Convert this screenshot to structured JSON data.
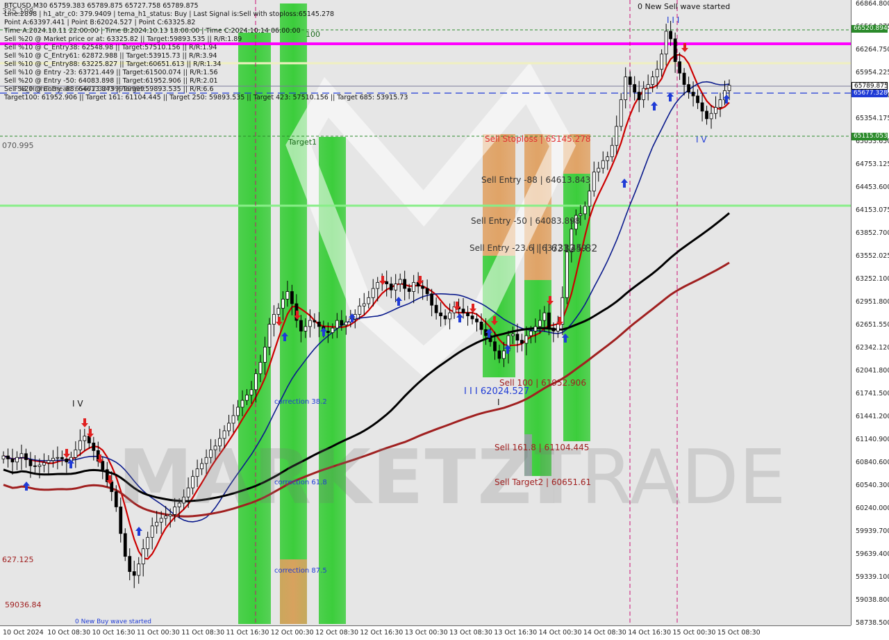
{
  "header": {
    "title_line": "BTCUSD,M30  65759.383 65789.875 65727.758 65789.875",
    "lines": [
      "Line:2898 | h1_atr_c0: 379.9409 | tema_h1_status: Buy | Last Signal is:Sell with stoploss:65145.278",
      "Point A:63397.441 | Point B:62024.527 | Point C:63325.82",
      "Time A:2024.10.11 22:00:00 | Time B:2024.10.13 18:00:00 | Time C:2024.10.14 06:00:00",
      "Sell %20 @ Market price or at: 63325.82 || Target:59893.535 || R/R:1.89",
      "Sell %10 @ C_Entry38: 62548.98 || Target:57510.156 || R/R:1.94",
      "Sell %10 @ C_Entry61: 62872.988 || Target:53915.73 || R/R:3.94",
      "Sell %10 @ C_Entry88: 63225.827 || Target:60651.613 || R/R:1.34",
      "Sell %10 @ Entry -23: 63721.449 || Target:61500.074 || R/R:1.56",
      "Sell %20 @ Entry -50: 64083.898 || Target:61952.906 || R/R:2.01",
      "Sell %20 @ Entry -88: 64613.843 || Target:59893.535 || R/R:6.6",
      "Target100: 61952.906 || Target 161: 61104.445 || Target 250: 59893.535 || Target 423: 57510.156 || Target 685: 53915.73"
    ],
    "overlap_text": "FSB_HighToBreak: 65677.32799999999"
  },
  "chart_labels": {
    "wave_title": "0 New Sell wave started",
    "wave_iii": "I I I",
    "wave_iv_top": "I V",
    "wave_iv_left": "I V",
    "sell_stoploss": "Sell Stoploss | 65145.278",
    "sell_entry_88": "Sell Entry -88 | 64613.843",
    "sell_entry_50": "Sell Entry -50 | 64083.898",
    "sell_entry_23": "Sell Entry -23.6 | 63721.449",
    "point_c": "| | | 63325.82",
    "sell_100": "Sell 100 | 61952.906",
    "point_b": "I I I 62024.527",
    "point_b_sub": "I",
    "sell_161": "Sell 161.8 | 61104.445",
    "sell_target2": "Sell Target2 | 60651.61",
    "target1": "Target1",
    "target_100": "100",
    "correction_38": "correction 38.2",
    "correction_61": "correction 61.8",
    "correction_87": "correction 87.5",
    "left_price_top": "325.108",
    "left_price_1": "070.995",
    "left_price_2": "627.125",
    "left_price_3": "59036.84",
    "bottom_text": "0 New Buy wave started"
  },
  "watermark": {
    "left": "MARKETZI",
    "right": "TRADE"
  },
  "y_axis": {
    "ticks": [
      "66864.800",
      "66564.275",
      "66264.750",
      "65954.225",
      "65654.700",
      "65354.175",
      "65053.650",
      "64753.125",
      "64453.600",
      "64153.075",
      "63852.700",
      "63552.025",
      "63252.100",
      "62951.800",
      "62651.550",
      "62342.120",
      "62041.800",
      "61741.500",
      "61441.200",
      "61140.900",
      "60840.600",
      "60540.300",
      "60240.000",
      "59939.700",
      "59639.400",
      "59339.100",
      "59038.800",
      "58738.500"
    ],
    "badges": [
      {
        "text": "66520.894",
        "color": "#2a8a2a"
      },
      {
        "text": "65789.875",
        "color": "#ffffff",
        "textColor": "#000000",
        "border": "#000000"
      },
      {
        "text": "65677.328",
        "color": "#1f3bd6"
      },
      {
        "text": "65115.053",
        "color": "#2a8a2a"
      }
    ]
  },
  "x_axis": {
    "ticks": [
      "10 Oct 2024",
      "10 Oct 08:30",
      "10 Oct 16:30",
      "11 Oct 00:30",
      "11 Oct 08:30",
      "11 Oct 16:30",
      "12 Oct 00:30",
      "12 Oct 08:30",
      "12 Oct 16:30",
      "13 Oct 00:30",
      "13 Oct 08:30",
      "13 Oct 16:30",
      "14 Oct 00:30",
      "14 Oct 08:30",
      "14 Oct 16:30",
      "15 Oct 00:30",
      "15 Oct 08:30"
    ]
  },
  "colors": {
    "bg": "#e6e6e6",
    "zone_green": "#33cc33",
    "zone_orange": "#e0a060",
    "zone_grey": "#9aa0a8",
    "magenta": "#ff00ff",
    "ma_red": "#cc0000",
    "ma_blue": "#0a1a8c",
    "ma_black": "#000000",
    "ma_darkred": "#a02020",
    "candle": "#000000"
  },
  "chart_data": {
    "type": "candlestick",
    "symbol": "BTCUSD",
    "timeframe": "M30",
    "last_ohlc": {
      "open": 65759.383,
      "high": 65789.875,
      "low": 65727.758,
      "close": 65789.875
    },
    "ylim": [
      58738.5,
      66864.8
    ],
    "levels": {
      "stoploss": 65145.278,
      "entry_88": 64613.843,
      "entry_50": 64083.898,
      "entry_23": 63721.449,
      "point_c": 63325.82,
      "sell_100": 61952.906,
      "point_b": 62024.527,
      "sell_161": 61104.445,
      "target2": 60651.61,
      "fsb_high": 65677.328,
      "last": 65789.875,
      "upper_green": 66520.894,
      "lower_green": 65115.053
    },
    "close_series": [
      60920,
      60880,
      60840,
      60900,
      60950,
      60870,
      60790,
      60780,
      60800,
      60830,
      60860,
      60890,
      60900,
      60880,
      60840,
      60900,
      61000,
      61120,
      61180,
      61090,
      60990,
      60850,
      60740,
      60580,
      60450,
      60250,
      59900,
      59600,
      59400,
      59350,
      59500,
      59700,
      59850,
      60000,
      60050,
      60100,
      60130,
      60150,
      60250,
      60300,
      60380,
      60500,
      60650,
      60750,
      60820,
      60900,
      61000,
      61050,
      61150,
      61250,
      61350,
      61450,
      61560,
      61650,
      61720,
      61790,
      62000,
      62150,
      62350,
      62650,
      62780,
      62860,
      62980,
      63080,
      62920,
      62700,
      62560,
      62620,
      62700,
      62680,
      62620,
      62560,
      62540,
      62600,
      62700,
      62640,
      62680,
      62720,
      62780,
      62890,
      62920,
      63000,
      63120,
      63200,
      63210,
      63180,
      63100,
      63180,
      63240,
      63120,
      63080,
      63200,
      63150,
      63120,
      63050,
      62900,
      62800,
      62760,
      62720,
      62800,
      62880,
      62850,
      62800,
      62760,
      62720,
      62680,
      62580,
      62500,
      62420,
      62300,
      62200,
      62300,
      62500,
      62520,
      62440,
      62400,
      62500,
      62560,
      62620,
      62700,
      62800,
      62600,
      62560,
      62650,
      63000,
      63600,
      63900,
      64080,
      64100,
      64200,
      64400,
      64650,
      64700,
      64800,
      64850,
      65000,
      65250,
      65600,
      65900,
      65800,
      65700,
      65600,
      65750,
      65800,
      65900,
      66000,
      66200,
      66500,
      66400,
      66100,
      65950,
      65800,
      65700,
      65650,
      65560,
      65450,
      65350,
      65420,
      65500,
      65600,
      65720,
      65789
    ]
  }
}
